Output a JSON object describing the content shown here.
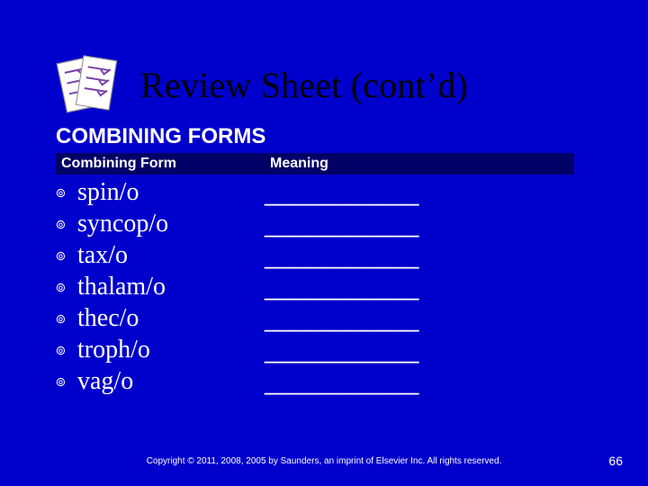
{
  "title": "Review Sheet (cont’d)",
  "icon_name": "clipboard-checklist-icon",
  "section_heading": "COMBINING FORMS",
  "columns": {
    "term": "Combining Form",
    "meaning": "Meaning"
  },
  "bullet_glyph": "๏",
  "blank_text": "___________",
  "rows": [
    {
      "term": "spin/o",
      "meaning": "___________"
    },
    {
      "term": "syncop/o",
      "meaning": "___________"
    },
    {
      "term": "tax/o",
      "meaning": "___________"
    },
    {
      "term": "thalam/o",
      "meaning": "___________"
    },
    {
      "term": "thec/o",
      "meaning": "___________"
    },
    {
      "term": "troph/o",
      "meaning": "___________"
    },
    {
      "term": "vag/o",
      "meaning": "___________"
    }
  ],
  "footer": "Copyright © 2011, 2008, 2005 by Saunders, an imprint of Elsevier Inc. All rights reserved.",
  "page_number": "66"
}
